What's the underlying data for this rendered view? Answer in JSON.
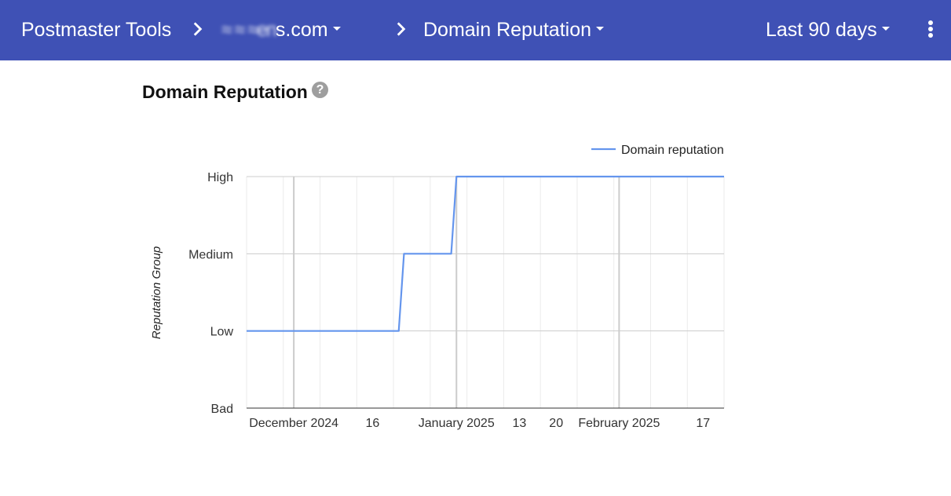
{
  "header": {
    "app_title": "Postmaster Tools",
    "domain_label": "s.com",
    "domain_obscured": "≈ ≈ ≈en",
    "section_label": "Domain Reputation",
    "range_label": "Last 90 days",
    "bg_color": "#3f51b5"
  },
  "page": {
    "title": "Domain Reputation",
    "help_glyph": "?"
  },
  "chart_data": {
    "type": "line",
    "title": "",
    "xlabel": "",
    "ylabel": "Reputation Group",
    "y_categories": [
      "Bad",
      "Low",
      "Medium",
      "High"
    ],
    "x_ticks": [
      "December 2024",
      "16",
      "January 2025",
      "13",
      "20",
      "February 2025",
      "17"
    ],
    "x_tick_dates": [
      "2024-12-01",
      "2024-12-16",
      "2025-01-01",
      "2025-01-13",
      "2025-01-20",
      "2025-02-01",
      "2025-02-17"
    ],
    "xlim": [
      "2024-11-22",
      "2025-02-21"
    ],
    "legend": {
      "position": "top-right"
    },
    "series": [
      {
        "name": "Domain reputation",
        "color": "#6495ed",
        "points": [
          {
            "x": "2024-11-22",
            "y": "Low"
          },
          {
            "x": "2024-12-21",
            "y": "Low"
          },
          {
            "x": "2024-12-22",
            "y": "Medium"
          },
          {
            "x": "2024-12-31",
            "y": "Medium"
          },
          {
            "x": "2025-01-01",
            "y": "High"
          },
          {
            "x": "2025-02-21",
            "y": "High"
          }
        ]
      }
    ]
  }
}
